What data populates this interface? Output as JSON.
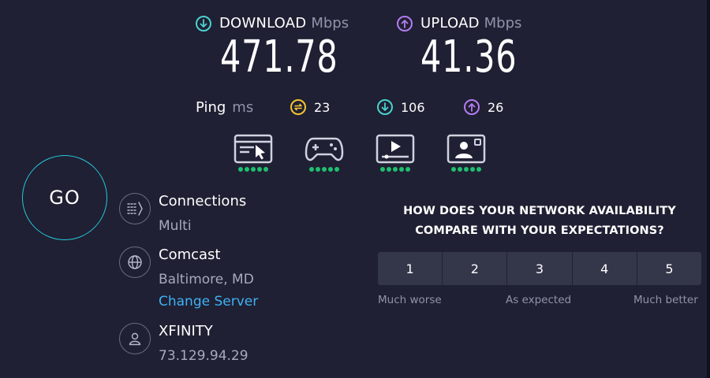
{
  "download": {
    "label": "DOWNLOAD",
    "unit": "Mbps",
    "value": "471.78",
    "color": "#4ad2cf"
  },
  "upload": {
    "label": "UPLOAD",
    "unit": "Mbps",
    "value": "41.36",
    "color": "#b57cf0"
  },
  "ping": {
    "label": "Ping",
    "unit": "ms",
    "idle": "23",
    "download": "106",
    "upload": "26",
    "idle_color": "#f4c531"
  },
  "quality": [
    {
      "icon": "web-browsing-icon",
      "rating": 5
    },
    {
      "icon": "gaming-icon",
      "rating": 5
    },
    {
      "icon": "video-streaming-icon",
      "rating": 5
    },
    {
      "icon": "video-chat-icon",
      "rating": 5
    }
  ],
  "go_label": "GO",
  "connections": {
    "title": "Connections",
    "value": "Multi"
  },
  "server": {
    "title": "Comcast",
    "location": "Baltimore, MD",
    "change_label": "Change Server"
  },
  "provider": {
    "title": "XFINITY",
    "ip": "73.129.94.29"
  },
  "survey": {
    "question_line1": "HOW DOES YOUR NETWORK AVAILABILITY",
    "question_line2": "COMPARE WITH YOUR EXPECTATIONS?",
    "options": [
      "1",
      "2",
      "3",
      "4",
      "5"
    ],
    "label_low": "Much worse",
    "label_mid": "As expected",
    "label_high": "Much better"
  },
  "colors": {
    "background": "#1f2033",
    "accent": "#26c6da",
    "link": "#3fb1f4",
    "good": "#1fc070"
  }
}
